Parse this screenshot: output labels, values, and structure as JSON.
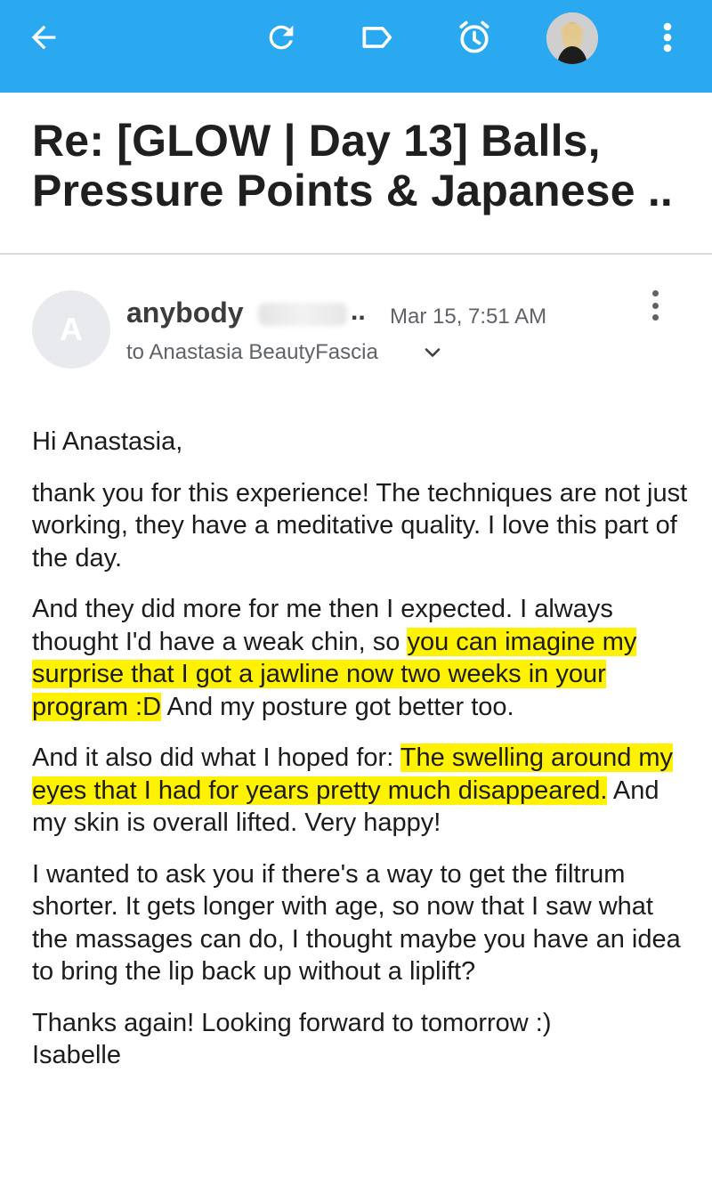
{
  "colors": {
    "appbar": "#2aa9f0",
    "highlight": "#fff200"
  },
  "toolbar": {
    "icons": [
      "back-arrow-icon",
      "refresh-icon",
      "label-icon",
      "snooze-icon",
      "account-avatar",
      "more-vert-icon"
    ]
  },
  "email": {
    "subject_line1": "Re: [GLOW | Day 13] Balls,",
    "subject_line2": "Pressure Points & Japanese ..",
    "sender_initial": "A",
    "sender_name": "anybody",
    "sender_ellipsis": "..",
    "date": "Mar 15, 7:51 AM",
    "recipient": "to  Anastasia BeautyFascia",
    "greeting": "Hi Anastasia,",
    "p1": "thank you for this experience! The techniques are not just working, they have a meditative quality. I love this part of the day.",
    "p2_a": "And they did more for me then I expected. I always thought I'd have a weak chin, so ",
    "p2_highlight": "you can imagine my surprise that I got a jawline now two weeks in your program :D",
    "p2_b": " And my posture got better too.",
    "p3_a": "And it also did what I hoped for: ",
    "p3_highlight": "The swelling around my eyes that I had for years pretty much disappeared.",
    "p3_b": " And my skin is overall lifted. Very happy!",
    "p4": "I wanted to ask you if there's a way to get the filtrum shorter. It gets longer with age, so now that I saw what the massages can do, I thought maybe you have an idea to bring the lip back up without a liplift?",
    "closing": "Thanks again! Looking forward to tomorrow :)",
    "signature": "Isabelle"
  }
}
